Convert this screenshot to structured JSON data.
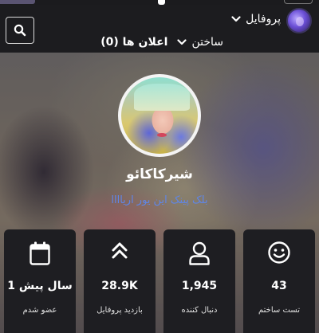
{
  "header": {
    "profile_label": "پروفایل",
    "nav": [
      {
        "label": "ساختن",
        "has_dropdown": true
      },
      {
        "label": "اعلان ها (0)",
        "has_dropdown": false
      }
    ],
    "search_icon": "search-icon"
  },
  "profile": {
    "display_name": "شیرکاکائو",
    "bio": "بلک پینک این یور اریاااا"
  },
  "stats": [
    {
      "icon": "smile-icon",
      "value": "43",
      "label": "تست ساختم"
    },
    {
      "icon": "user-icon",
      "value": "1,945",
      "label": "دنبال کننده"
    },
    {
      "icon": "double-chevron-up-icon",
      "value": "28.9K",
      "label": "بازدید پروفایل"
    },
    {
      "icon": "calendar-icon",
      "value": "1 سال پیش",
      "label": "عضو شدم"
    }
  ],
  "colors": {
    "background": "#1c1c1f",
    "card": "#1e1e22",
    "bio_link": "#5f86e8"
  }
}
